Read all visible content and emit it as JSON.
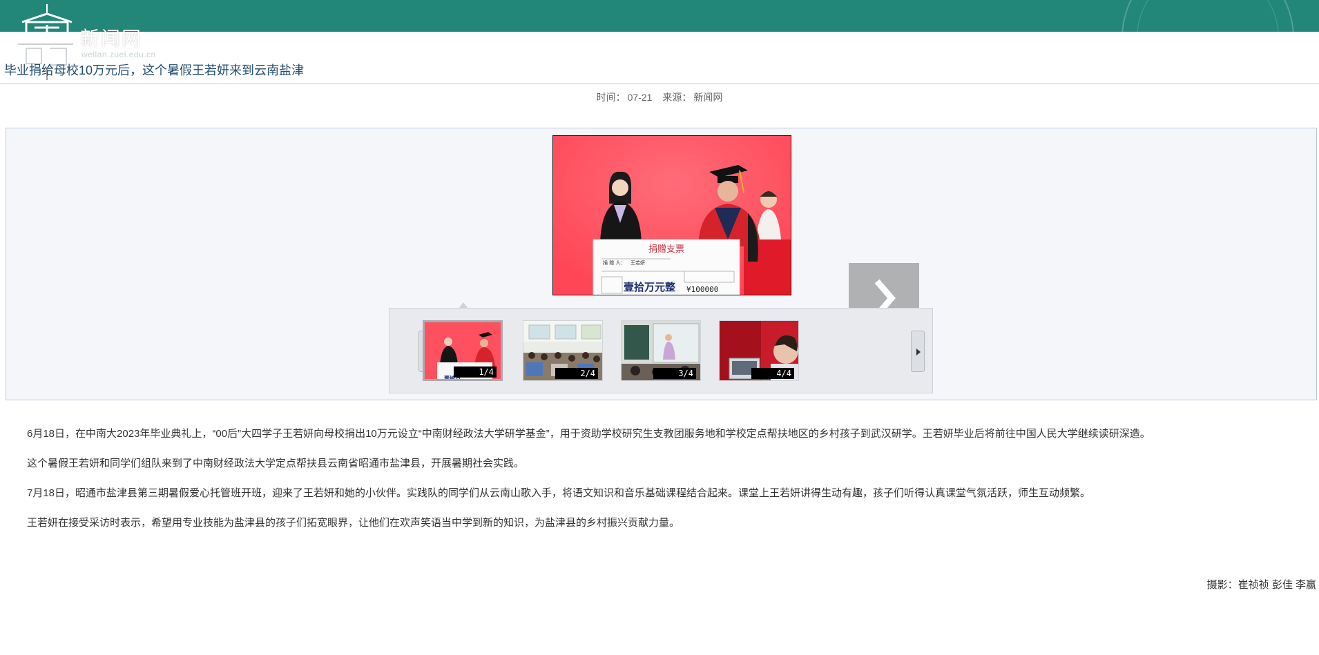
{
  "header": {
    "site_name": "新闻网",
    "site_domain": "wellan.zuel.edu.cn",
    "band_color": "#228779"
  },
  "article": {
    "title": "毕业捐给母校10万元后，这个暑假王若妍来到云南盐津",
    "time_label": "时间：",
    "time_value": "07-21",
    "source_label": "来源：",
    "source_value": "新闻网"
  },
  "gallery": {
    "next_icon": "chevron-right-icon",
    "prev_strip_icon": "triangle-left-icon",
    "next_strip_icon": "triangle-right-icon",
    "active_index": 1,
    "thumbnails": [
      {
        "counter": "1/4",
        "scene": "graduation-ceremony"
      },
      {
        "counter": "2/4",
        "scene": "classroom"
      },
      {
        "counter": "3/4",
        "scene": "blackboard-lesson"
      },
      {
        "counter": "4/4",
        "scene": "interview"
      }
    ],
    "cheque_title": "捐赠支票",
    "cheque_amount": "壹拾万元整",
    "cheque_figure": "¥100000",
    "cheque_donor": "王若妍"
  },
  "body": {
    "paragraphs": [
      "6月18日，在中南大2023年毕业典礼上，“00后”大四学子王若妍向母校捐出10万元设立“中南财经政法大学研学基金”，用于资助学校研究生支教团服务地和学校定点帮扶地区的乡村孩子到武汉研学。王若妍毕业后将前往中国人民大学继续读研深造。",
      "这个暑假王若妍和同学们组队来到了中南财经政法大学定点帮扶县云南省昭通市盐津县，开展暑期社会实践。",
      "7月18日，昭通市盐津县第三期暑假爱心托管班开班，迎来了王若妍和她的小伙伴。实践队的同学们从云南山歌入手，将语文知识和音乐基础课程结合起来。课堂上王若妍讲得生动有趣，孩子们听得认真课堂气氛活跃，师生互动频繁。",
      "王若妍在接受采访时表示，希望用专业技能为盐津县的孩子们拓宽眼界，让他们在欢声笑语当中学到新的知识，为盐津县的乡村振兴贡献力量。"
    ],
    "photo_credit": "摄影：崔祯祯 彭佳 李赢"
  }
}
